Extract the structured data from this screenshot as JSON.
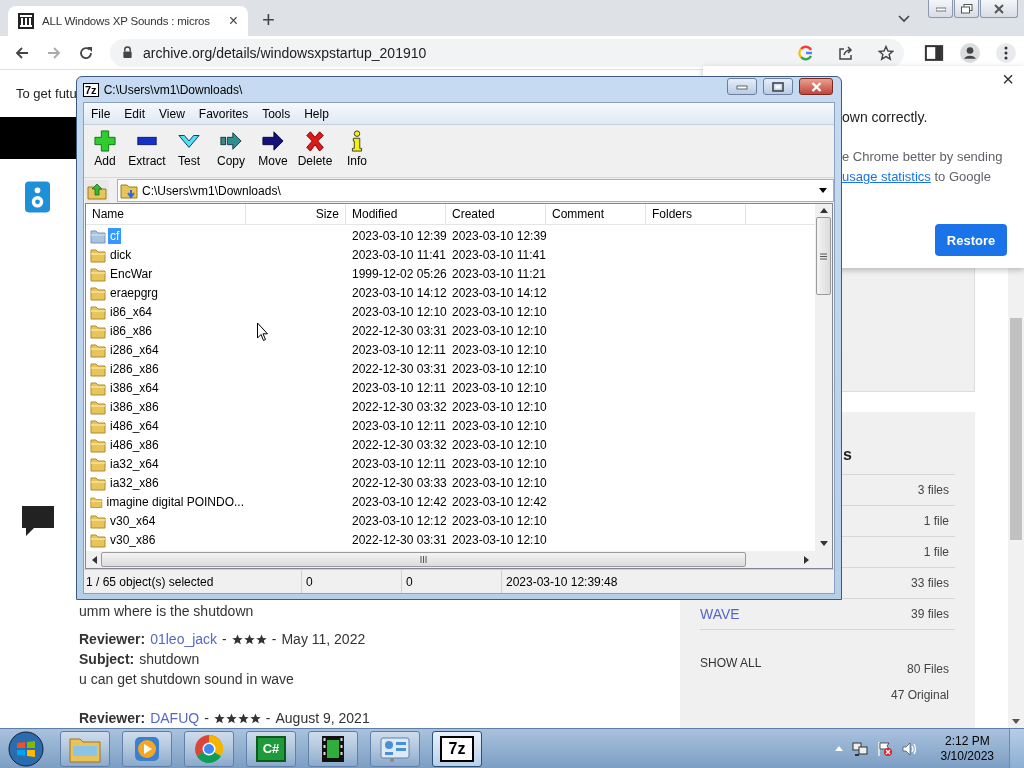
{
  "browser": {
    "tab": {
      "title": "ALL Windows XP Sounds : micros",
      "close": "×",
      "selected": true
    },
    "new_tab": "+",
    "url": "archive.org/details/windowsxpstartup_201910"
  },
  "page": {
    "notice": "To get futu",
    "reviews": [
      {
        "body": "umm where is the shutdown"
      },
      {
        "reviewer_label": "Reviewer:",
        "reviewer": "01leo_jack",
        "sep_before": "-",
        "stars": 3,
        "sep_after": "-",
        "date": "May 11, 2022",
        "subject_label": "Subject:",
        "subject": "shutdown",
        "body": "u can get shutdown sound in wave"
      },
      {
        "reviewer_label": "Reviewer:",
        "reviewer": "DAFUQ",
        "sep_before": "-",
        "stars": 4,
        "sep_after": "-",
        "date": "August 9, 2021"
      }
    ],
    "files_panel": {
      "heading": "s",
      "rows": [
        {
          "count": "3 files"
        },
        {
          "count": "1 file"
        },
        {
          "count": "1 file"
        },
        {
          "count": "33 files"
        },
        {
          "label": "WAVE",
          "count": "39 files"
        }
      ],
      "show_all": "SHOW ALL",
      "total": "80 Files",
      "original": "47 Original"
    },
    "popup": {
      "close": "×",
      "lines": [
        "own correctly.",
        "e Chrome better by sending"
      ],
      "link": "usage statistics",
      "link_tail": " to Google",
      "button": "Restore"
    }
  },
  "archiver": {
    "logo": "7z",
    "title": "C:\\Users\\vm1\\Downloads\\",
    "menu": [
      "File",
      "Edit",
      "View",
      "Favorites",
      "Tools",
      "Help"
    ],
    "toolbar": [
      {
        "kind": "add",
        "label": "Add"
      },
      {
        "kind": "extract",
        "label": "Extract"
      },
      {
        "kind": "test",
        "label": "Test"
      },
      {
        "kind": "copy",
        "label": "Copy"
      },
      {
        "kind": "move",
        "label": "Move"
      },
      {
        "kind": "delete",
        "label": "Delete"
      },
      {
        "kind": "info",
        "label": "Info"
      }
    ],
    "path": "C:\\Users\\vm1\\Downloads\\",
    "columns": [
      "Name",
      "Size",
      "Modified",
      "Created",
      "Comment",
      "Folders"
    ],
    "rows": [
      {
        "name": "cf",
        "modified": "2023-03-10 12:39",
        "created": "2023-03-10 12:39",
        "selected": true
      },
      {
        "name": "dick",
        "modified": "2023-03-10 11:41",
        "created": "2023-03-10 11:41",
        "selected": false
      },
      {
        "name": "EncWar",
        "modified": "1999-12-02 05:26",
        "created": "2023-03-10 11:21",
        "selected": false
      },
      {
        "name": "eraepgrg",
        "modified": "2023-03-10 14:12",
        "created": "2023-03-10 14:12",
        "selected": false
      },
      {
        "name": "i86_x64",
        "modified": "2023-03-10 12:10",
        "created": "2023-03-10 12:10",
        "selected": false
      },
      {
        "name": "i86_x86",
        "modified": "2022-12-30 03:31",
        "created": "2023-03-10 12:10",
        "selected": false
      },
      {
        "name": "i286_x64",
        "modified": "2023-03-10 12:11",
        "created": "2023-03-10 12:10",
        "selected": false
      },
      {
        "name": "i286_x86",
        "modified": "2022-12-30 03:31",
        "created": "2023-03-10 12:10",
        "selected": false
      },
      {
        "name": "i386_x64",
        "modified": "2023-03-10 12:11",
        "created": "2023-03-10 12:10",
        "selected": false
      },
      {
        "name": "i386_x86",
        "modified": "2022-12-30 03:32",
        "created": "2023-03-10 12:10",
        "selected": false
      },
      {
        "name": "i486_x64",
        "modified": "2023-03-10 12:11",
        "created": "2023-03-10 12:10",
        "selected": false
      },
      {
        "name": "i486_x86",
        "modified": "2022-12-30 03:32",
        "created": "2023-03-10 12:10",
        "selected": false
      },
      {
        "name": "ia32_x64",
        "modified": "2023-03-10 12:11",
        "created": "2023-03-10 12:10",
        "selected": false
      },
      {
        "name": "ia32_x86",
        "modified": "2022-12-30 03:33",
        "created": "2023-03-10 12:10",
        "selected": false
      },
      {
        "name": "imagine digital POINDO...",
        "modified": "2023-03-10 12:42",
        "created": "2023-03-10 12:42",
        "selected": false
      },
      {
        "name": "v30_x64",
        "modified": "2023-03-10 12:12",
        "created": "2023-03-10 12:10",
        "selected": false
      },
      {
        "name": "v30_x86",
        "modified": "2022-12-30 03:31",
        "created": "2023-03-10 12:10",
        "selected": false
      }
    ],
    "status": [
      "1 / 65 object(s) selected",
      "0",
      "0",
      "2023-03-10 12:39:48"
    ]
  },
  "taskbar": {
    "items": [
      {
        "kind": "explorer",
        "selected": false
      },
      {
        "kind": "media",
        "selected": false
      },
      {
        "kind": "chrome",
        "selected": false
      },
      {
        "kind": "code",
        "label": "C#",
        "selected": false
      },
      {
        "kind": "film",
        "selected": false
      },
      {
        "kind": "panel",
        "selected": false
      },
      {
        "kind": "archiver",
        "label": "7z",
        "selected": true
      }
    ],
    "time": "2:12 PM",
    "date": "3/10/2023"
  }
}
